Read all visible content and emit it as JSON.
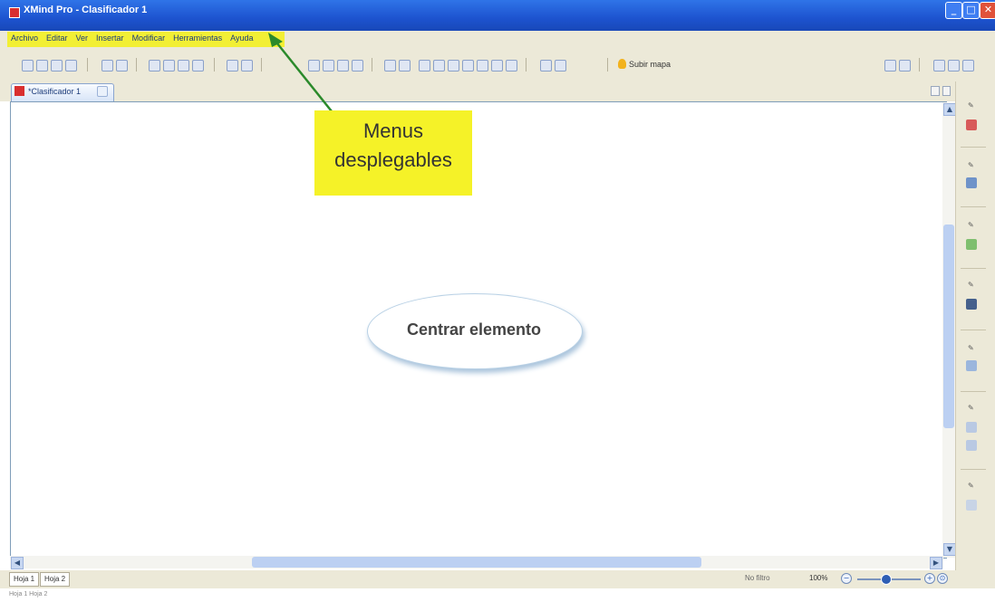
{
  "window": {
    "title": "XMind Pro - Clasificador 1",
    "controls": {
      "minimize": "_",
      "maximize": "□",
      "close": "✕"
    }
  },
  "menu": {
    "items": [
      "Archivo",
      "Editar",
      "Ver",
      "Insertar",
      "Modificar",
      "Herramientas",
      "Ayuda"
    ]
  },
  "toolbar": {
    "new_map_label": "Subir mapa",
    "icons": [
      "new-icon",
      "open-icon",
      "save-icon",
      "save-as-icon",
      "undo-icon",
      "redo-icon",
      "cut-icon",
      "copy-icon",
      "paste-icon",
      "delete-icon",
      "topic-icon",
      "subtopic-icon",
      "image-icon",
      "bulb-icon"
    ]
  },
  "tabs": {
    "document": "*Clasificador 1"
  },
  "canvas": {
    "central_topic": "Centrar elemento"
  },
  "annotation": {
    "line1": "Menus",
    "line2": "desplegables",
    "color": "#f5f228",
    "arrow_color": "#2b8a2b"
  },
  "sheets": [
    "Hoja 1",
    "Hoja 2"
  ],
  "status": {
    "filter": "No filtro",
    "zoom": "100%"
  },
  "footer": {
    "text": "Hoja 1 Hoja 2"
  },
  "colors": {
    "titlebar": "#1d53cf",
    "chrome": "#ece9d8",
    "menu_highlight": "#f2ef34"
  }
}
